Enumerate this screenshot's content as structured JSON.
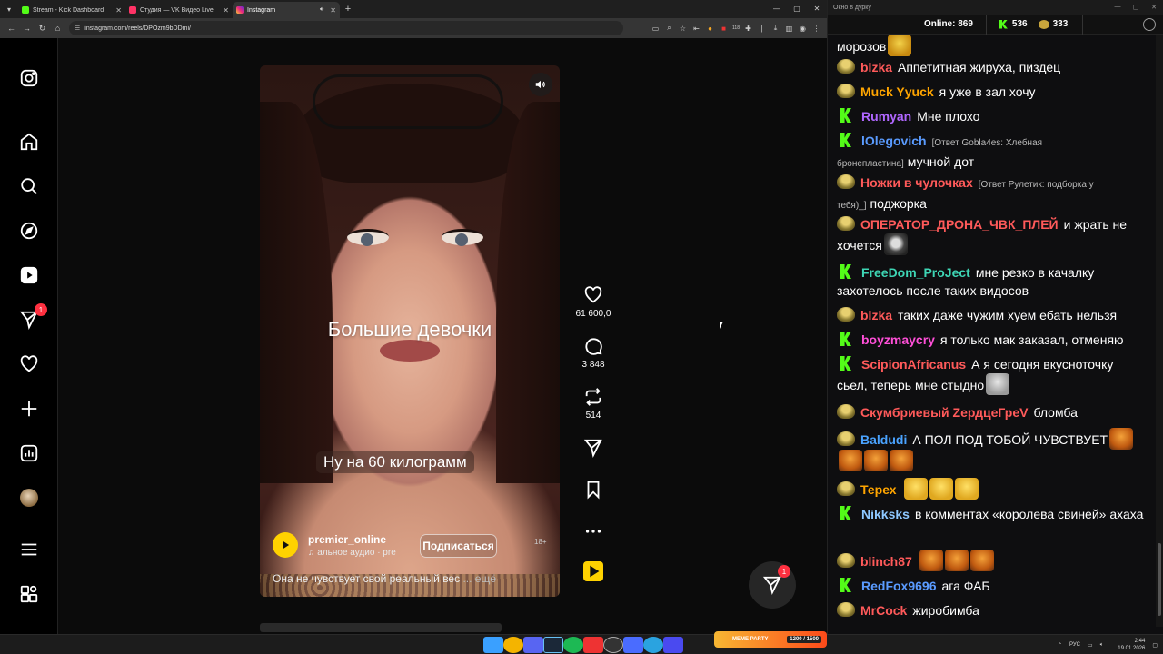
{
  "browser": {
    "tabs": [
      {
        "label": "Stream - Kick Dashboard",
        "color": "#53fc18",
        "active": false
      },
      {
        "label": "Студия — VK Видео Live",
        "color": "#ff3366",
        "active": false
      },
      {
        "label": "Instagram",
        "color": "#e1306c",
        "active": true
      }
    ],
    "url": "instagram.com/reels/DPOzm9bDDmi/",
    "ext_badge": "118"
  },
  "reel": {
    "title": "Большие девочки",
    "subtitle": "Ну на 60 килограмм",
    "owner": "premier_online",
    "audio": "альное аудио · pre",
    "follow_label": "Подписаться",
    "age_mark": "18+",
    "caption": "Она не чувствует свой реальный вес",
    "caption_more": "... ещё",
    "likes": "61 600,0",
    "comments": "3 848",
    "reposts": "514"
  },
  "sidebar": {
    "notifications_badge": "1"
  },
  "messages_fab_badge": "1",
  "chat": {
    "window_title": "Окно в дурку",
    "online_label": "Online:",
    "online_count": "869",
    "kick_count": "536",
    "yt_count": "333",
    "messages": [
      {
        "platform": "yt",
        "user": "",
        "text": "морозов",
        "color": "#ffffff",
        "emotes": [
          "gold"
        ]
      },
      {
        "platform": "yt",
        "user": "blzka",
        "color": "#ff5a5a",
        "text": "Аппетитная жируха, пиздец"
      },
      {
        "platform": "yt",
        "user": "Muck Yyuck",
        "color": "#ffa500",
        "text": "я уже в зал хочу"
      },
      {
        "platform": "kick",
        "user": "Rumyan",
        "color": "#b067ff",
        "text": "Мне плохо"
      },
      {
        "platform": "kick",
        "user": "lOlegovich",
        "color": "#5a9bff",
        "reply": "[Ответ Gobla4es: Хлебная бронепластина]",
        "text": "мучной дот"
      },
      {
        "platform": "yt",
        "user": "Ножки в чулочках",
        "color": "#ff5a5a",
        "reply": "[Ответ Рулетик: подборка у тебя)_]",
        "text": "поджорка"
      },
      {
        "platform": "yt",
        "user": "ОПЕРАТОР_ДРОНА_ЧВК_ПЛЕЙ",
        "color": "#ff5a5a",
        "text": "и жрать не хочется",
        "emotes": [
          "racoon"
        ]
      },
      {
        "platform": "kick",
        "user": "FreeDom_ProJect",
        "color": "#3ed6b5",
        "text": "мне резко в качалку захотелось после таких видосов"
      },
      {
        "platform": "yt",
        "user": "blzka",
        "color": "#ff5a5a",
        "text": "таких даже чужим хуем ебать нельзя"
      },
      {
        "platform": "kick",
        "user": "boyzmaycry",
        "color": "#ff4fd8",
        "text": "я только мак заказал, отменяю"
      },
      {
        "platform": "kick",
        "user": "ScipionAfricanus",
        "color": "#ff5a5a",
        "text": "А я сегодня вкусноточку сьел, теперь мне стыдно",
        "emotes": [
          "grey"
        ]
      },
      {
        "platform": "yt",
        "user": "Скумбриевый ZердцеГреV",
        "color": "#ff5a5a",
        "text": "бломба"
      },
      {
        "platform": "yt",
        "user": "Baldudi",
        "color": "#4aa3ff",
        "text": "А ПОЛ ПОД ТОБОЙ ЧУВСТВУЕТ",
        "emotes": [
          "tiger",
          "tiger",
          "tiger",
          "tiger"
        ]
      },
      {
        "platform": "yt",
        "user": "Терех",
        "color": "#ffa500",
        "text": "",
        "emotes": [
          "laugh",
          "laugh",
          "laugh"
        ]
      },
      {
        "platform": "kick",
        "user": "Nikksks",
        "color": "#8ec8ff",
        "text": "в комментах «королева свиней» ахаха"
      },
      {
        "platform": "yt",
        "user": "blinch87",
        "color": "#ff5a5a",
        "text": "",
        "emotes": [
          "tiger",
          "tiger",
          "tiger"
        ]
      },
      {
        "platform": "kick",
        "user": "RedFox9696",
        "color": "#5a9bff",
        "text": "ага ФАБ"
      },
      {
        "platform": "yt",
        "user": "MrCock",
        "color": "#ff5a5a",
        "text": "жиробимба"
      }
    ]
  },
  "taskbar": {
    "widget_label": "MEME PARTY",
    "widget_value": "1200 / 1500",
    "lang": "РУС",
    "time": "2:44",
    "date": "19.01.2026"
  }
}
